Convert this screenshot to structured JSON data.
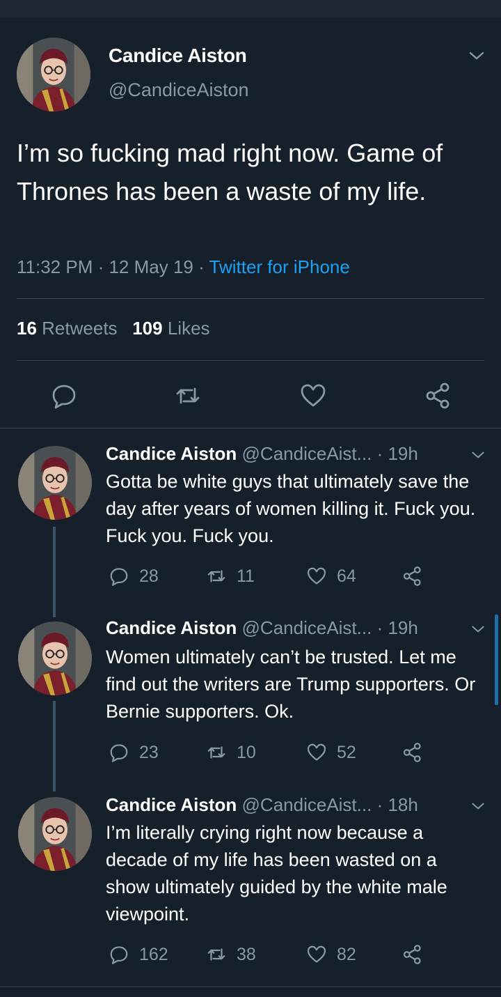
{
  "main_tweet": {
    "name": "Candice Aiston",
    "handle": "@CandiceAiston",
    "text": "I’m so fucking mad right now. Game of Thrones has been a waste of my life.",
    "time": "11:32 PM",
    "date": "12 May 19",
    "separator": " · ",
    "source": "Twitter for iPhone",
    "retweets_count": "16",
    "retweets_label": "Retweets",
    "likes_count": "109",
    "likes_label": "Likes"
  },
  "replies": [
    {
      "name": "Candice Aiston",
      "handle": "@CandiceAist...",
      "time": "· 19h",
      "text": "Gotta be white guys that ultimately save the day after years of women killing it. Fuck you. Fuck you. Fuck you.",
      "replies": "28",
      "retweets": "11",
      "likes": "64"
    },
    {
      "name": "Candice Aiston",
      "handle": "@CandiceAist...",
      "time": "· 19h",
      "text": "Women ultimately can’t be trusted. Let me find out the writers are Trump supporters. Or Bernie supporters. Ok.",
      "replies": "23",
      "retweets": "10",
      "likes": "52"
    },
    {
      "name": "Candice Aiston",
      "handle": "@CandiceAist...",
      "time": "· 18h",
      "text": "I’m literally crying right now because a decade of my life has been wasted on a show ultimately guided by the white male viewpoint.",
      "replies": "162",
      "retweets": "38",
      "likes": "82"
    }
  ],
  "colors": {
    "background": "#15202b",
    "secondary_text": "#8899a6",
    "accent": "#1da1f2",
    "divider": "#38444d"
  },
  "icons": [
    "chevron-down-icon",
    "reply-icon",
    "retweet-icon",
    "like-icon",
    "share-icon"
  ]
}
